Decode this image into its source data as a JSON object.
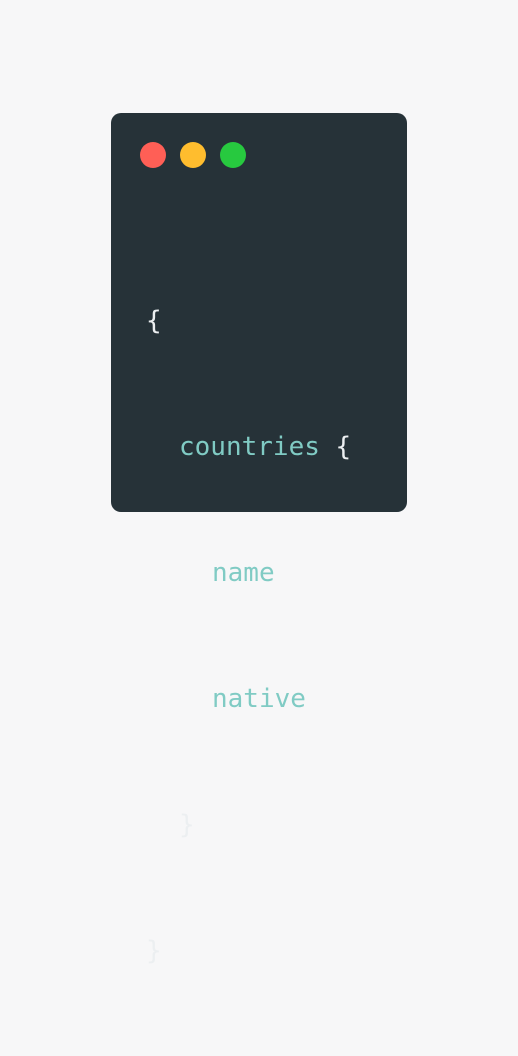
{
  "window": {
    "traffic_lights": [
      {
        "name": "close",
        "color": "#ff5f56"
      },
      {
        "name": "minimize",
        "color": "#ffbd2e"
      },
      {
        "name": "maximize",
        "color": "#27c93f"
      }
    ]
  },
  "code": {
    "open_brace": "{",
    "field_countries": "countries",
    "countries_open_brace": "{",
    "field_name": "name",
    "field_native": "native",
    "countries_close_brace": "}",
    "close_brace": "}"
  },
  "colors": {
    "background": "#f7f7f8",
    "window": "#263238",
    "field": "#80cbc4",
    "punctuation": "#eceff1"
  }
}
